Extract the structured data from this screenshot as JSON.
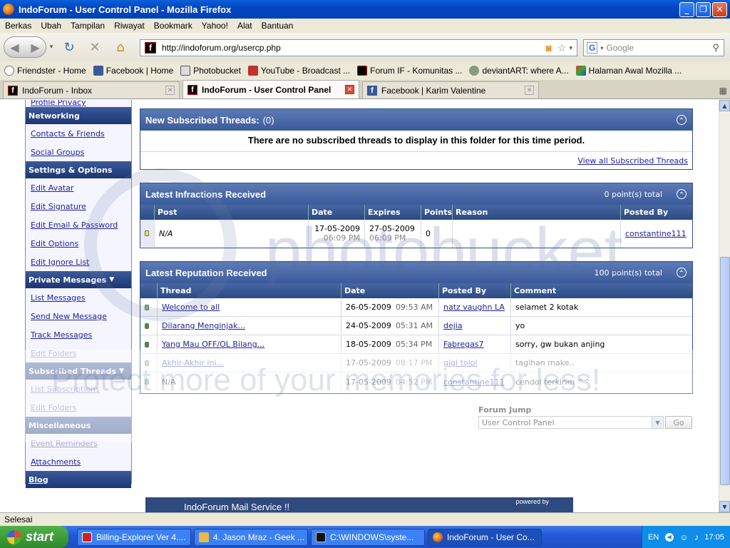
{
  "window": {
    "title": "IndoForum - User Control Panel - Mozilla Firefox"
  },
  "menu": [
    "Berkas",
    "Ubah",
    "Tampilan",
    "Riwayat",
    "Bookmark",
    "Yahoo!",
    "Alat",
    "Bantuan"
  ],
  "address": {
    "url": "http://indoforum.org/usercp.php"
  },
  "search": {
    "placeholder": "Google"
  },
  "bookmarks": [
    "Friendster - Home",
    "Facebook | Home",
    "Photobucket",
    "YouTube - Broadcast ...",
    "Forum IF - Komunitas ...",
    "deviantART: where A...",
    "Halaman Awal Mozilla ..."
  ],
  "tabs": [
    "IndoForum - Inbox",
    "IndoForum - User Control Panel",
    "Facebook | Karim Valentine"
  ],
  "sidebar": {
    "profile_privacy": "Profile Privacy",
    "networking": "Networking",
    "contacts": "Contacts & Friends",
    "social_groups": "Social Groups",
    "settings": "Settings & Options",
    "edit_avatar": "Edit Avatar",
    "edit_signature": "Edit Signature",
    "edit_email": "Edit Email & Password",
    "edit_options": "Edit Options",
    "edit_ignore": "Edit Ignore List",
    "private_messages": "Private Messages",
    "list_messages": "List Messages",
    "send_message": "Send New Message",
    "track_messages": "Track Messages",
    "edit_folders": "Edit Folders",
    "subscribed_threads": "Subscribed Threads",
    "list_subscriptions": "List Subscriptions",
    "edit_folders2": "Edit Folders",
    "misc": "Miscellaneous",
    "event_reminders": "Event Reminders",
    "attachments": "Attachments",
    "blog": "Blog"
  },
  "subscribed": {
    "title": "New Subscribed Threads:",
    "count": "(0)",
    "message": "There are no subscribed threads to display in this folder for this time period.",
    "view_all": "View all Subscribed Threads"
  },
  "infractions": {
    "title": "Latest Infractions Received",
    "total": "0 point(s) total",
    "headers": [
      "Post",
      "Date",
      "Expires",
      "Points",
      "Reason",
      "Posted By"
    ],
    "row": {
      "post": "N/A",
      "date": "17-05-2009",
      "date_time": "06:09 PM",
      "expires": "27-05-2009",
      "expires_time": "06:09 PM",
      "points": "0",
      "reason": "",
      "posted_by": "constantine111"
    }
  },
  "reputation": {
    "title": "Latest Reputation Received",
    "total": "100 point(s) total",
    "headers": [
      "Thread",
      "Date",
      "Posted By",
      "Comment"
    ],
    "rows": [
      {
        "thread": "Welcome to all",
        "date": "26-05-2009",
        "time": "09:53 AM",
        "by": "natz vaughn LA",
        "comment": "selamet 2 kotak"
      },
      {
        "thread": "Dilarang Menginjak...",
        "date": "24-05-2009",
        "time": "05:31 AM",
        "by": "dejia",
        "comment": "yo"
      },
      {
        "thread": "Yang Mau OFF/OL Bilang...",
        "date": "18-05-2009",
        "time": "05:34 PM",
        "by": "Fabregas7",
        "comment": "sorry, gw bukan anjing"
      },
      {
        "thread": "Akhir-Akhir ini...",
        "date": "17-05-2009",
        "time": "08:17 PM",
        "by": "gigi tolol",
        "comment": "tagihan make.."
      },
      {
        "thread": "N/A",
        "date": "17-05-2009",
        "time": "04:52 PM",
        "by": "constantine111",
        "comment": "cendol terkirim ^^"
      }
    ]
  },
  "forum_jump": {
    "label": "Forum Jump",
    "selected": "User Control Panel",
    "go": "Go"
  },
  "footer": {
    "text": "IndoForum Mail Service !!",
    "powered": "powered by"
  },
  "watermark": {
    "logo": "photobucket",
    "tagline": "Protect more of your memories for less!"
  },
  "statusbar": {
    "text": "Selesai"
  },
  "taskbar": {
    "start": "start",
    "items": [
      "Billing-Explorer Ver 4....",
      "4. Jason Mraz - Geek ...",
      "C:\\WINDOWS\\syste...",
      "IndoForum - User Co..."
    ],
    "lang": "EN",
    "clock": "17:05"
  }
}
